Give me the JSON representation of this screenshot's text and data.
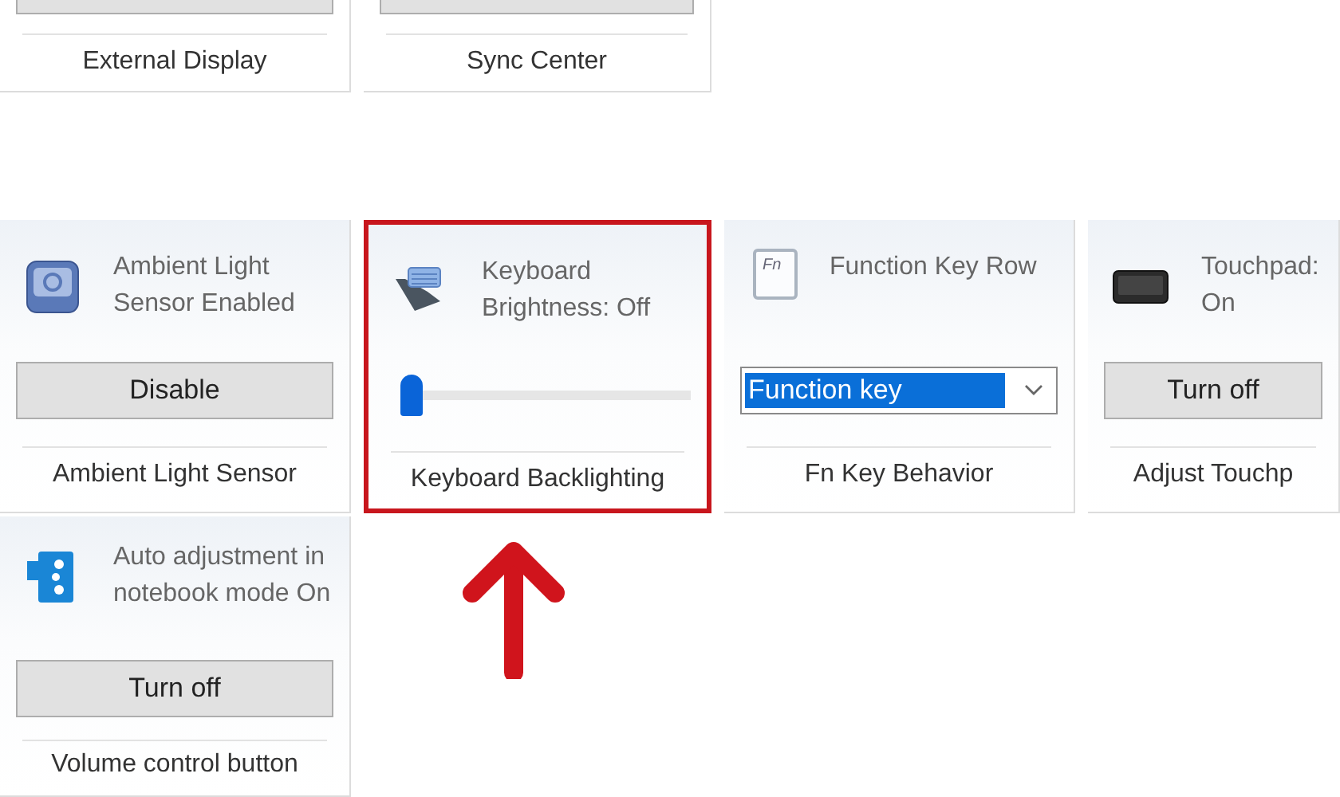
{
  "rows": [
    {
      "tiles": [
        {
          "kind": "stub",
          "title": "External Display",
          "highlighted": false
        },
        {
          "kind": "stub",
          "title": "Sync Center",
          "highlighted": false
        }
      ]
    },
    {
      "tiles": [
        {
          "kind": "button",
          "status": "Ambient Light Sensor Enabled",
          "button": "Disable",
          "title": "Ambient Light Sensor",
          "highlighted": false
        },
        {
          "kind": "slider",
          "status": "Keyboard Brightness: Off",
          "level": 0,
          "title": "Keyboard Backlighting",
          "highlighted": true
        },
        {
          "kind": "select",
          "icon_text": "Fn",
          "status": "Function Key Row",
          "value": "Function key",
          "title": "Fn Key Behavior",
          "highlighted": false
        },
        {
          "kind": "button",
          "status": "Touchpad: On",
          "button": "Turn off",
          "title": "Adjust Touchp",
          "highlighted": false
        }
      ]
    },
    {
      "tiles": [
        {
          "kind": "button",
          "status": "Auto adjustment in notebook mode On",
          "button": "Turn off",
          "title": "Volume control button",
          "highlighted": false
        }
      ]
    }
  ]
}
